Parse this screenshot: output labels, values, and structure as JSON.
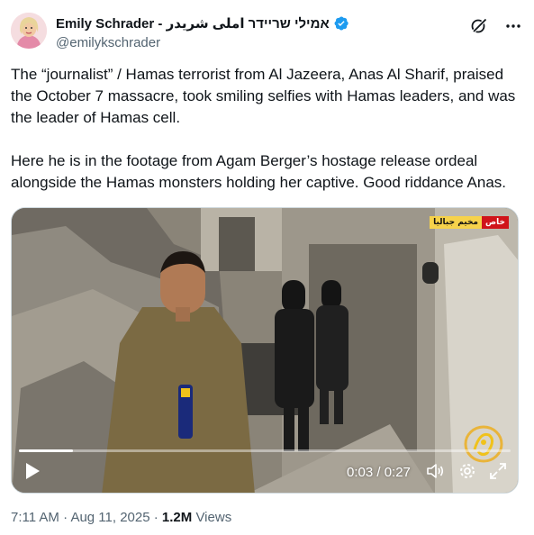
{
  "author": {
    "display_name": "Emily Schrader - אמילי שריידר املی شریدر",
    "handle": "@emilykschrader",
    "verified": true,
    "avatar_icon": "profile-photo"
  },
  "header_actions": [
    "grok-icon",
    "more-icon"
  ],
  "tweet": {
    "paragraph_1": "The “journalist” / Hamas terrorist from Al Jazeera, Anas Al Sharif, praised the October 7 massacre,  took smiling selfies with Hamas leaders, and was the leader of Hamas cell.",
    "paragraph_2": "Here he is in the footage from Agam Berger’s hostage release ordeal alongside the Hamas monsters holding her captive. Good riddance Anas."
  },
  "media": {
    "channel_tag_place": "مخيم جباليا",
    "channel_tag_live": "خاص",
    "progress": 0.11,
    "time": "0:03 / 0:27",
    "logo_icon": "al-jazeera-logo"
  },
  "footer": {
    "time": "7:11 AM",
    "separator_1": "·",
    "date": "Aug 11, 2025",
    "separator_2": "·",
    "views_count": "1.2M",
    "views_label": "Views"
  },
  "colors": {
    "text": "#0f1419",
    "secondary": "#536471",
    "verified": "#1d9bf0",
    "border": "#cfd9de"
  }
}
